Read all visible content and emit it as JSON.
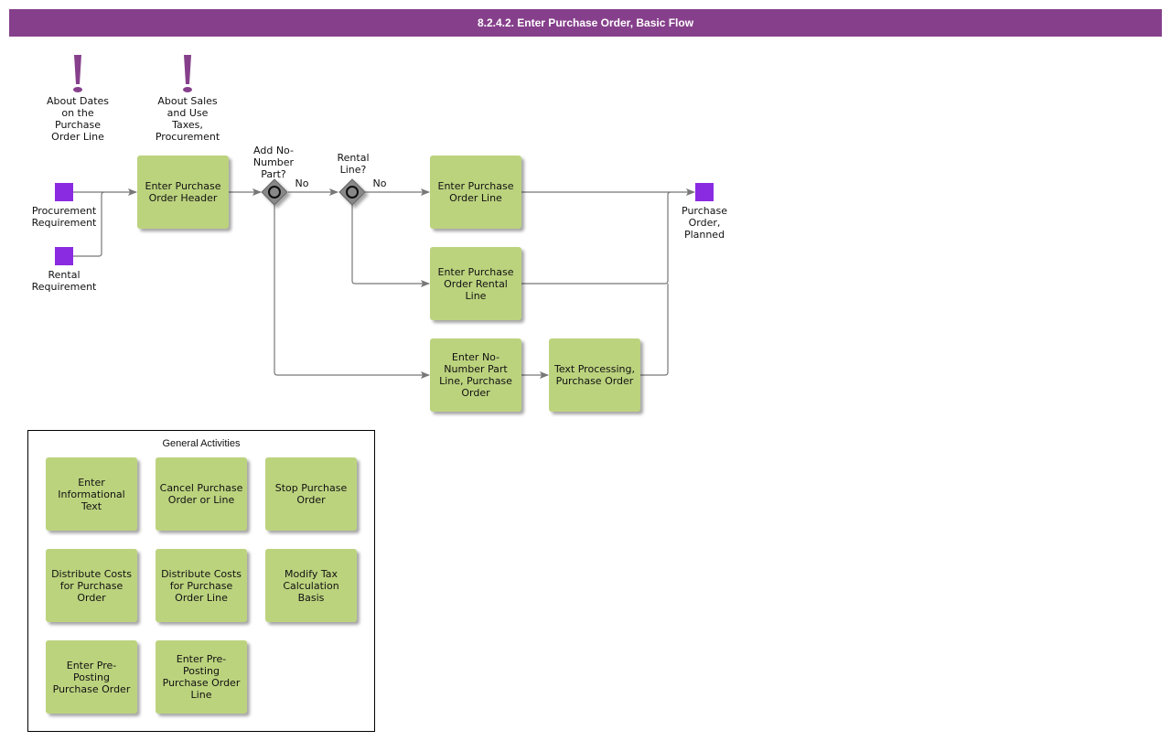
{
  "title": "8.2.4.2. Enter Purchase Order, Basic Flow",
  "annotations": [
    {
      "icon": "exclamation-icon",
      "label": "About Dates\non the\nPurchase\nOrder Line"
    },
    {
      "icon": "exclamation-icon",
      "label": "About Sales\nand Use\nTaxes,\nProcurement"
    }
  ],
  "events": {
    "procurement": "Procurement\nRequirement",
    "rental": "Rental\nRequirement",
    "end": "Purchase\nOrder,\nPlanned"
  },
  "gateways": {
    "no_number": {
      "question": "Add No-\nNumber\nPart?",
      "branch": "No"
    },
    "rental": {
      "question": "Rental\nLine?",
      "branch": "No"
    }
  },
  "tasks": {
    "header": "Enter Purchase\nOrder Header",
    "line": "Enter Purchase\nOrder Line",
    "rental_line": "Enter Purchase\nOrder Rental\nLine",
    "no_number_line": "Enter No-\nNumber Part\nLine, Purchase\nOrder",
    "text_processing": "Text Processing,\nPurchase Order"
  },
  "general_activities": {
    "title": "General Activities",
    "items": [
      "Enter\nInformational\nText",
      "Cancel Purchase\nOrder or Line",
      "Stop Purchase\nOrder",
      "Distribute Costs\nfor Purchase\nOrder",
      "Distribute Costs\nfor Purchase\nOrder Line",
      "Modify Tax\nCalculation\nBasis",
      "Enter Pre-\nPosting\nPurchase Order",
      "Enter Pre-\nPosting\nPurchase Order\nLine"
    ]
  },
  "colors": {
    "header": "#86408b",
    "task": "#bcd37e",
    "event": "#8a2be2",
    "connector": "#777777"
  }
}
